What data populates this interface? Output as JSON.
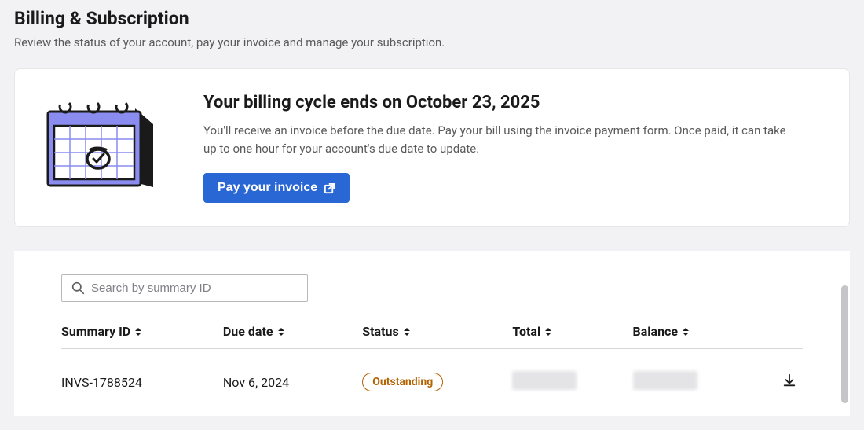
{
  "page": {
    "title": "Billing & Subscription",
    "subtitle": "Review the status of your account, pay your invoice and manage your subscription."
  },
  "billing_card": {
    "heading": "Your billing cycle ends on October 23, 2025",
    "description": "You'll receive an invoice before the due date. Pay your bill using the invoice payment form. Once paid, it can take up to one hour for your account's due date to update.",
    "button_label": "Pay your invoice"
  },
  "search": {
    "placeholder": "Search by summary ID"
  },
  "table": {
    "columns": {
      "summary_id": "Summary ID",
      "due_date": "Due date",
      "status": "Status",
      "total": "Total",
      "balance": "Balance"
    },
    "rows": [
      {
        "summary_id": "INVS-1788524",
        "due_date": "Nov 6, 2024",
        "status": "Outstanding",
        "total": "",
        "balance": ""
      }
    ]
  }
}
